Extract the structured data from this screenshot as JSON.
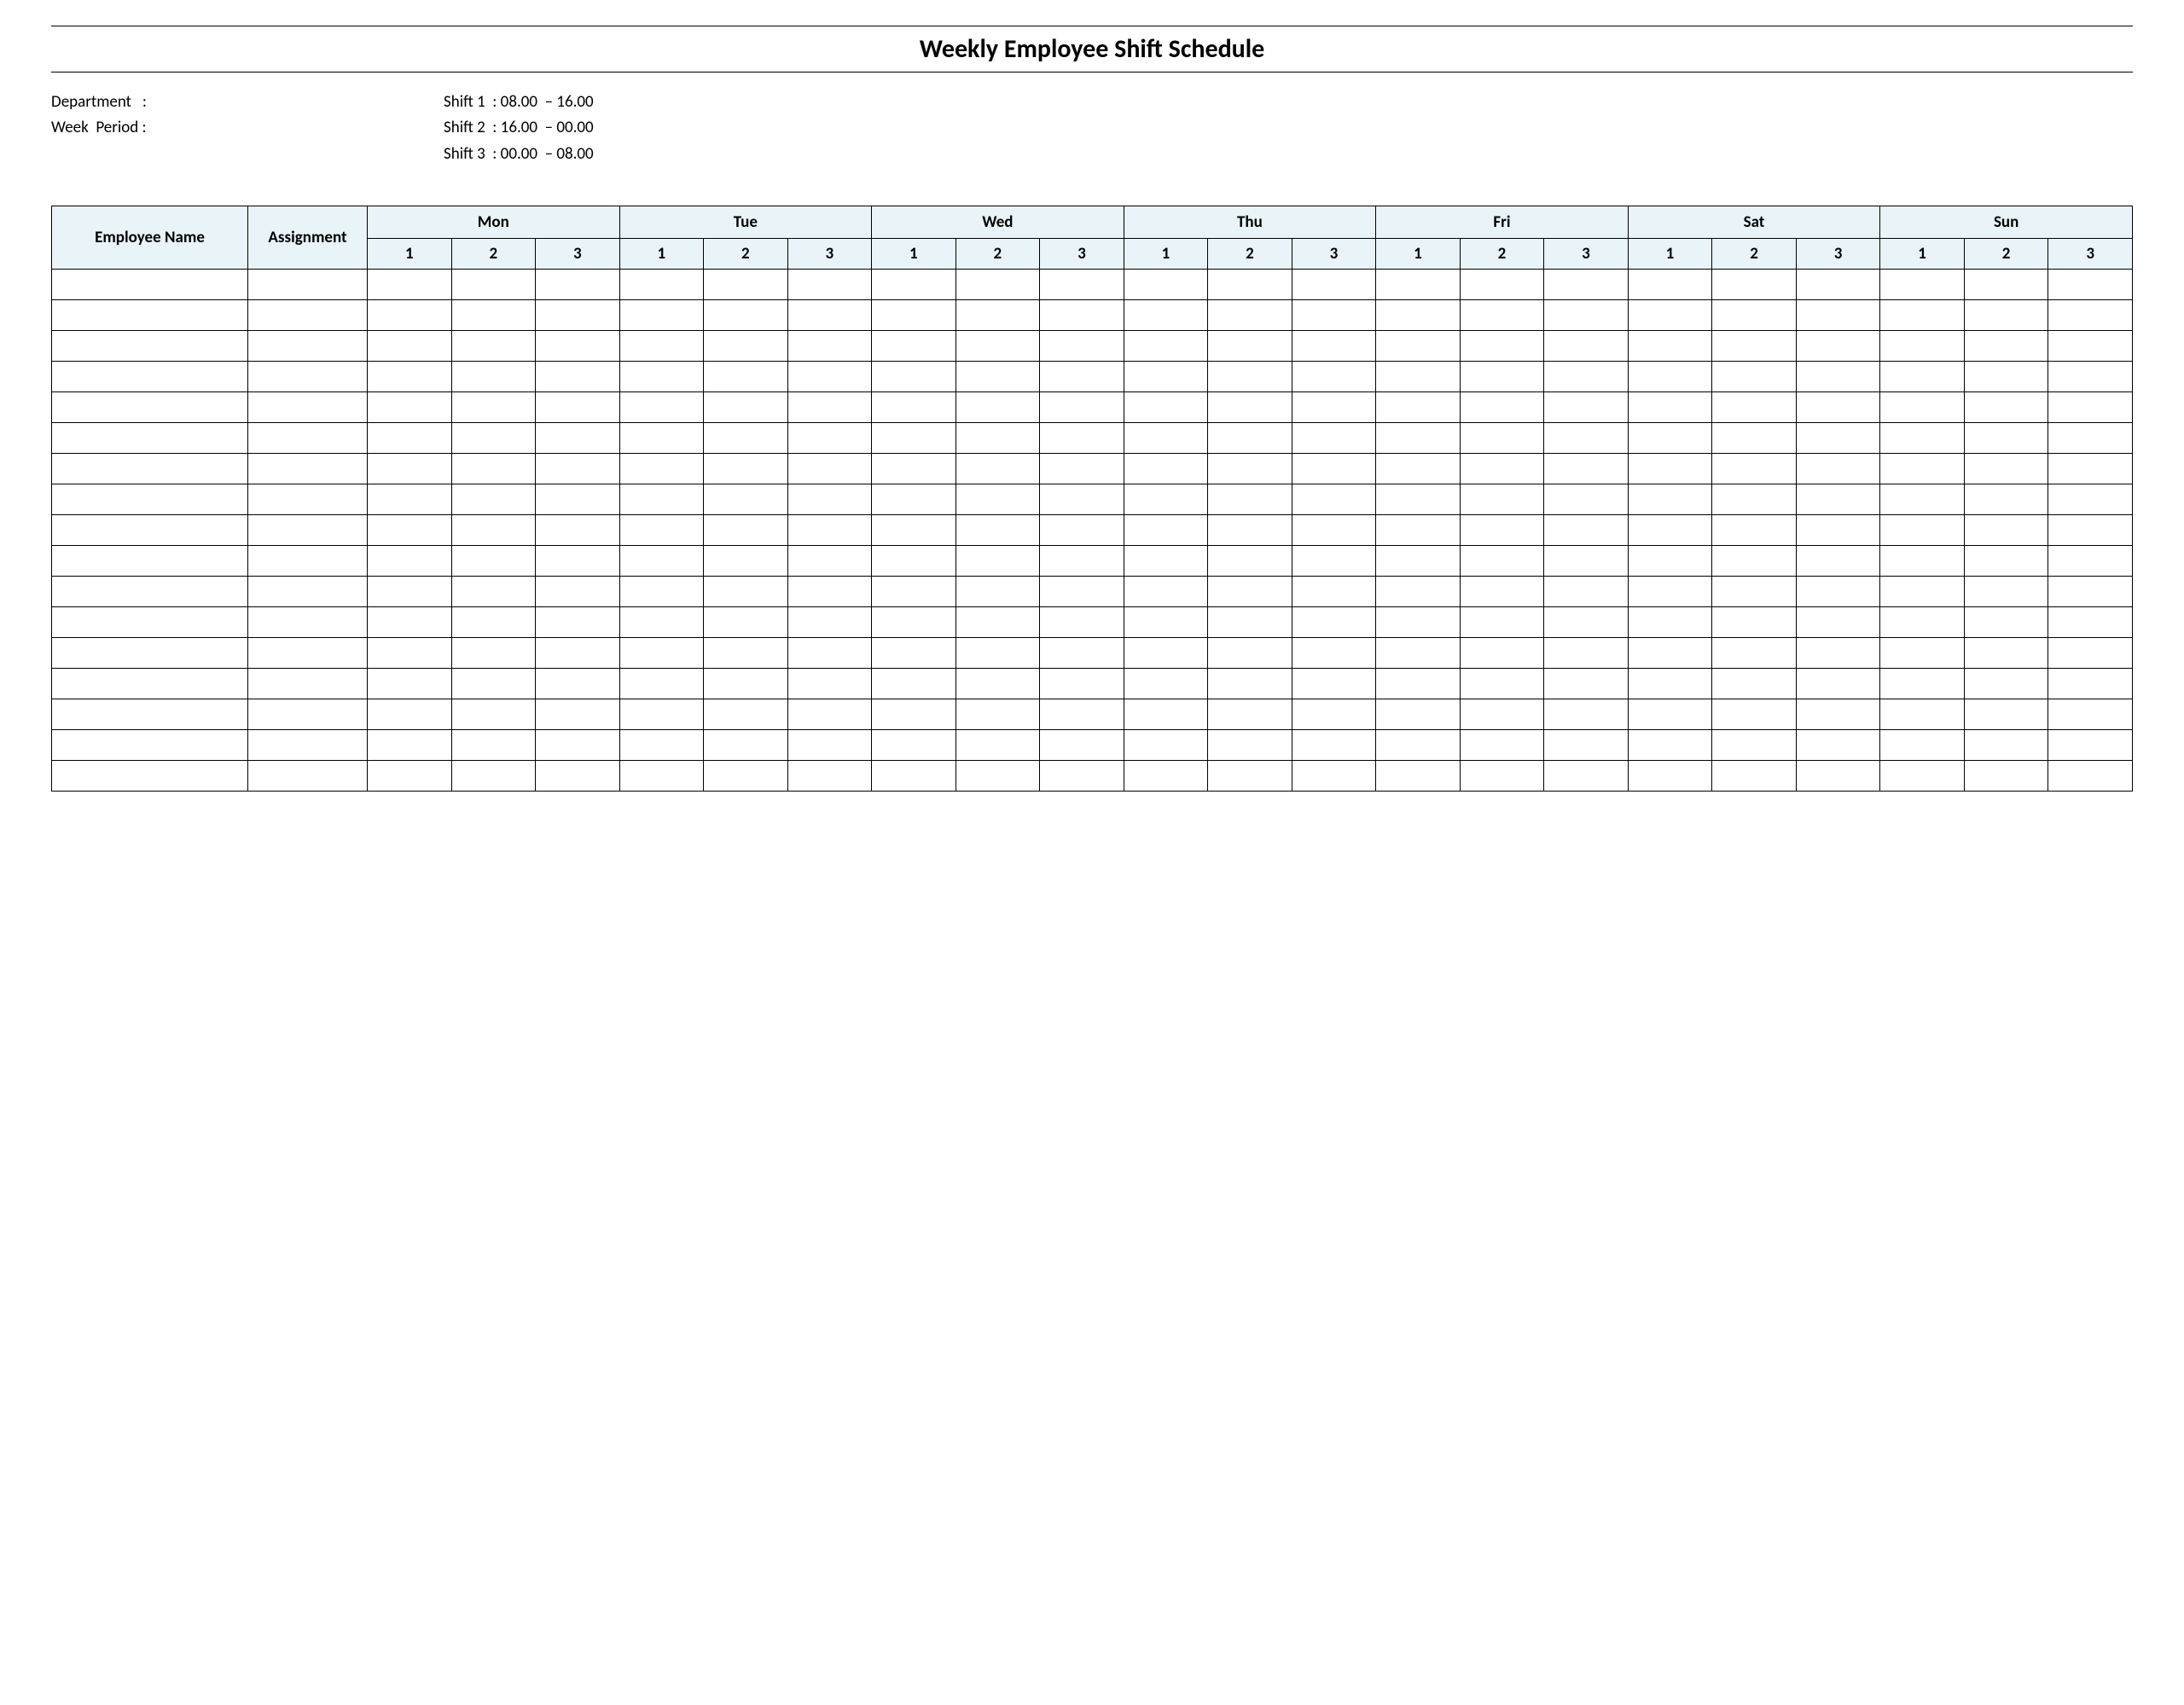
{
  "title": "Weekly Employee Shift Schedule",
  "info_left": [
    {
      "label": "Department",
      "sep": "   :",
      "value": ""
    },
    {
      "label": "Week  Period",
      "sep": " :",
      "value": ""
    }
  ],
  "info_right": [
    {
      "label": "Shift 1",
      "sep": "  :",
      "value": " 08.00  – 16.00"
    },
    {
      "label": "Shift 2",
      "sep": "  :",
      "value": " 16.00  – 00.00"
    },
    {
      "label": "Shift 3",
      "sep": "  :",
      "value": " 00.00  – 08.00"
    }
  ],
  "columns": {
    "name": "Employee Name",
    "assignment": "Assignment"
  },
  "days": [
    "Mon",
    "Tue",
    "Wed",
    "Thu",
    "Fri",
    "Sat",
    "Sun"
  ],
  "shift_numbers": [
    "1",
    "2",
    "3"
  ],
  "body_row_count": 17
}
